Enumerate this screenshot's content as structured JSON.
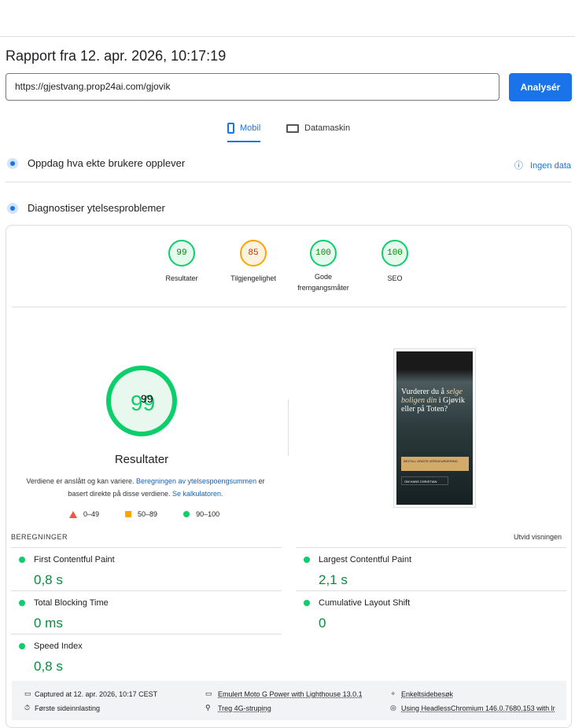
{
  "title": "Rapport fra 12. apr. 2026, 10:17:19",
  "url": "https://gjestvang.prop24ai.com/gjovik",
  "analyze": "Analysér",
  "tabs": [
    "Mobil",
    "Datamaskin"
  ],
  "field": {
    "title": "Oppdag hva ekte brukere opplever",
    "nodata": "Ingen data"
  },
  "diag": {
    "title": "Diagnostiser ytelsesproblemer"
  },
  "gauges": [
    {
      "score": "99",
      "label": "Resultater"
    },
    {
      "score": "85",
      "label": "Tilgjengelighet"
    },
    {
      "score": "100",
      "label": "Gode fremgangsmåter"
    },
    {
      "score": "100",
      "label": "SEO"
    }
  ],
  "main": {
    "score": "99",
    "label": "Resultater",
    "desc1": "Verdiene er anslått og kan variere. ",
    "link1": "Beregningen av ytelsespoengsummen",
    "desc2": " er basert direkte på disse verdiene. ",
    "link2": "Se kalkulatoren."
  },
  "legend": [
    "0–49",
    "50–89",
    "90–100"
  ],
  "screenshot": {
    "headline1": "Vurderer du å",
    "headline2": "selge boligen din",
    "headline3": "i Gjøvik eller på Toten?",
    "cta1": "BESTILL GRATIS VERDIVURDERING",
    "cta2": "OM HANS CHRISTIAN"
  },
  "metrics": {
    "heading": "BEREGNINGER",
    "expand": "Utvid visningen",
    "items": [
      {
        "name": "First Contentful Paint",
        "value": "0,8 s"
      },
      {
        "name": "Largest Contentful Paint",
        "value": "2,1 s"
      },
      {
        "name": "Total Blocking Time",
        "value": "0 ms"
      },
      {
        "name": "Cumulative Layout Shift",
        "value": "0"
      },
      {
        "name": "Speed Index",
        "value": "0,8 s"
      }
    ]
  },
  "footer": [
    "Captured at 12. apr. 2026, 10:17 CEST",
    "Emulert Moto G Power with Lighthouse 13.0.1",
    "Enkeltsidebesøk",
    "Første sideinnlasting",
    "Treg 4G-struping",
    "Using HeadlessChromium 146.0.7680.153 with lr"
  ],
  "colors": {
    "accent": "#1a73e8",
    "pass": "#0cce6b",
    "average": "#ffa400",
    "fail": "#ff4e42"
  }
}
